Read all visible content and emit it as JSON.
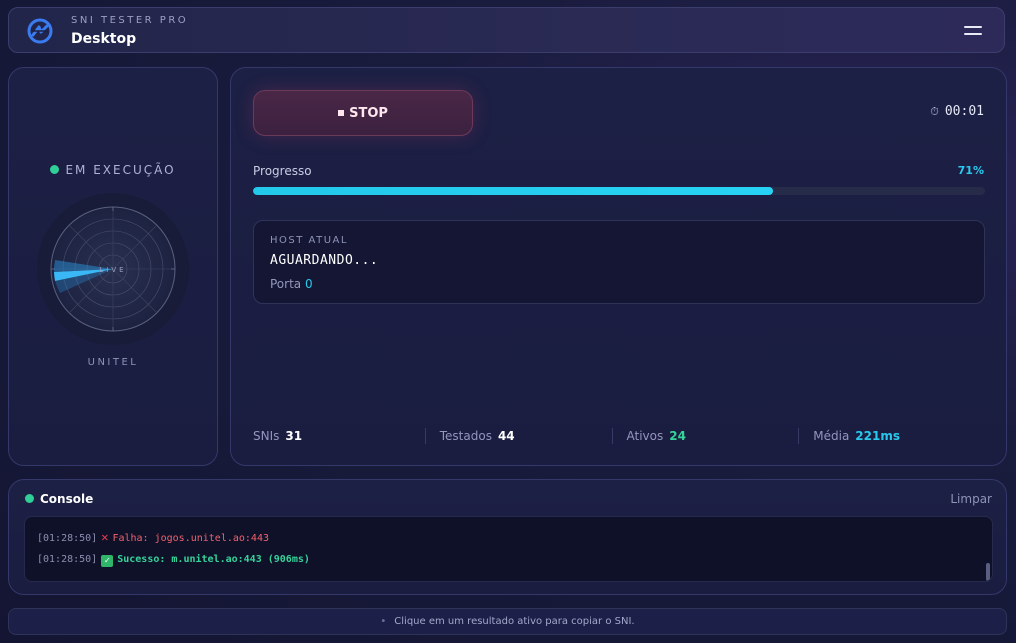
{
  "header": {
    "brand": "SNI TESTER PRO",
    "title": "Desktop",
    "logo_icon": "logo-icon",
    "menu_icon": "hamburger-menu-icon"
  },
  "scanner": {
    "status": "EM EXECUÇÃO",
    "status_color": "#2fcf97",
    "radar_label": "LIVE",
    "operator": "UNITEL"
  },
  "controls": {
    "stop_label": "STOP",
    "timer": "00:01",
    "timer_icon": "stopwatch-icon"
  },
  "progress": {
    "label": "Progresso",
    "value_text": "71%",
    "fraction": 0.71,
    "color": "#23c9ea"
  },
  "host": {
    "label": "HOST ATUAL",
    "value": "AGUARDANDO...",
    "port_label": "Porta",
    "port_value": "0"
  },
  "stats": [
    {
      "label": "SNIs",
      "value": "31",
      "color": "#ffffff"
    },
    {
      "label": "Testados",
      "value": "44",
      "color": "#ffffff"
    },
    {
      "label": "Ativos",
      "value": "24",
      "color": "#36d39a"
    },
    {
      "label": "Média",
      "value": "221ms",
      "color": "#29c9ee"
    }
  ],
  "console": {
    "title": "Console",
    "clear_label": "Limpar",
    "lines": [
      {
        "time": "[01:28:50]",
        "status": "fail",
        "icon": "cross-mark-icon",
        "text": "Falha: jogos.unitel.ao:443"
      },
      {
        "time": "[01:28:50]",
        "status": "ok",
        "icon": "check-mark-icon",
        "text": "Sucesso: m.unitel.ao:443 (906ms)"
      }
    ]
  },
  "footer": {
    "hint": "Clique em um resultado ativo para copiar o SNI."
  }
}
